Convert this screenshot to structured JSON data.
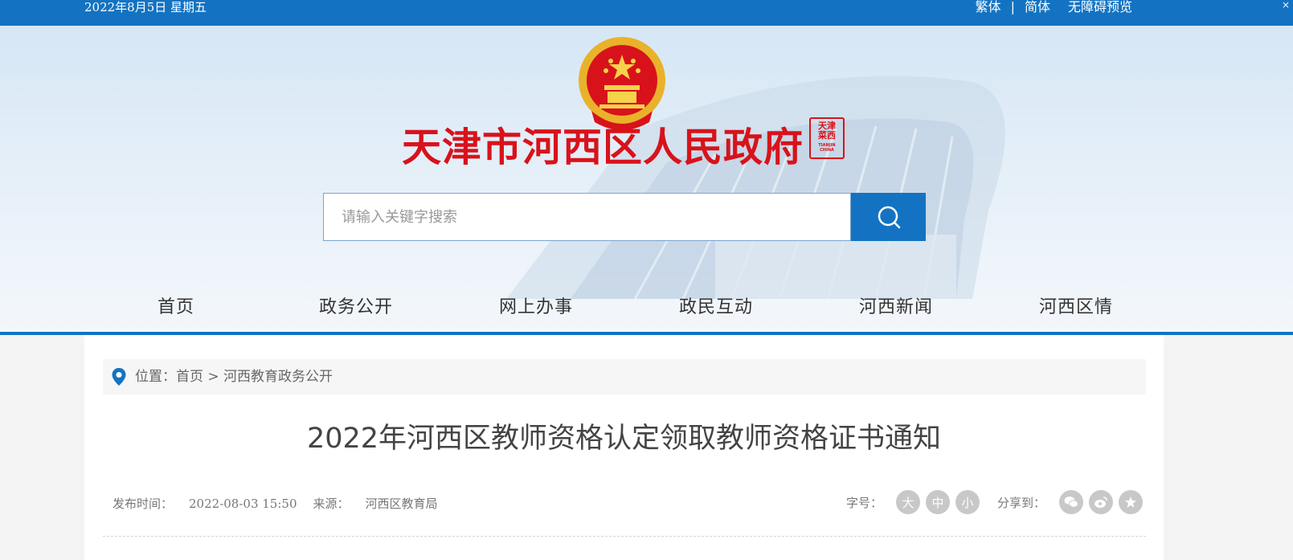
{
  "topbar": {
    "date": "2022年8月5日 星期五",
    "traditional": "繁体",
    "separator": "|",
    "simplified": "简体",
    "accessibility": "无障碍预览",
    "corner": "×"
  },
  "header": {
    "site_title": "天津市河西区人民政府",
    "seal_text": "天津\n菜西",
    "seal_en": "TIANJIN CHINA",
    "search_placeholder": "请输入关键字搜索"
  },
  "nav": {
    "items": [
      "首页",
      "政务公开",
      "网上办事",
      "政民互动",
      "河西新闻",
      "河西区情"
    ]
  },
  "breadcrumb": {
    "prefix": "位置：",
    "home": "首页",
    "arrow": " > ",
    "current": "河西教育政务公开"
  },
  "article": {
    "title": "2022年河西区教师资格认定领取教师资格证书通知",
    "publish_label": "发布时间：",
    "publish_time": "2022-08-03 15:50",
    "source_label": "来源：",
    "source": "河西区教育局",
    "font_size_label": "字号：",
    "font_large": "大",
    "font_medium": "中",
    "font_small": "小",
    "share_label": "分享到："
  },
  "colors": {
    "brand_blue": "#1373c2",
    "title_red": "#d8121b"
  }
}
